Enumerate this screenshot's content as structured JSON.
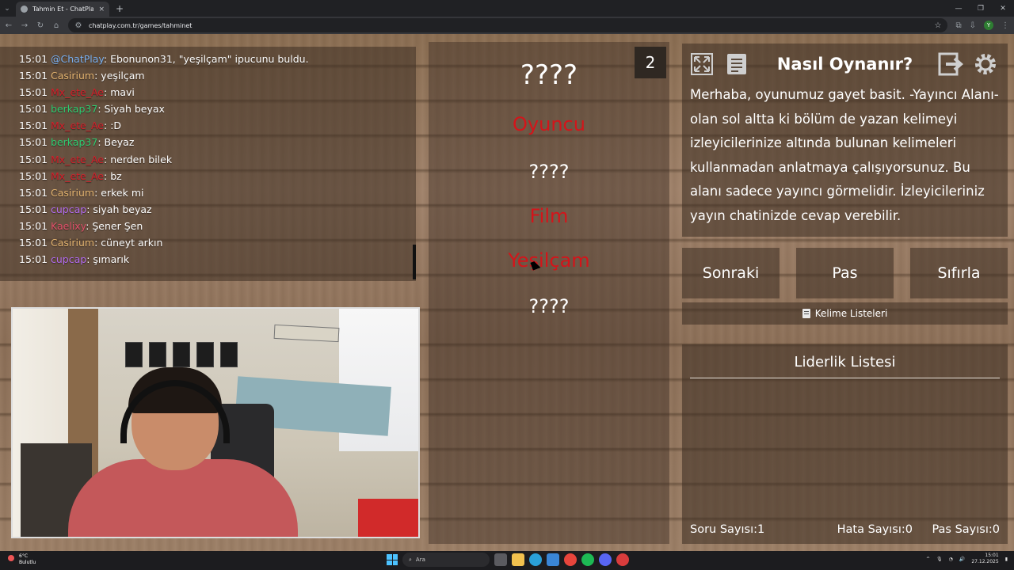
{
  "browser": {
    "tab_title": "Tahmin Et - ChatPlay",
    "url": "chatplay.com.tr/games/tahminet",
    "tab_close": "×",
    "new_tab": "+",
    "profile_initial": "Y"
  },
  "chat": {
    "messages": [
      {
        "time": "15:01",
        "user": "@ChatPlay",
        "color": "#7ab0f0",
        "text": ": Ebonunon31, \"yeşilçam\" ipucunu buldu."
      },
      {
        "time": "15:01",
        "user": "Casirium",
        "color": "#e3b36f",
        "text": ": yeşilçam"
      },
      {
        "time": "15:01",
        "user": "Mx_ete_Ae",
        "color": "#d41e2a",
        "text": ": mavi"
      },
      {
        "time": "15:01",
        "user": "berkap37",
        "color": "#2ecc71",
        "text": ": Siyah beyax"
      },
      {
        "time": "15:01",
        "user": "Mx_ete_Ae",
        "color": "#d41e2a",
        "text": ": :D"
      },
      {
        "time": "15:01",
        "user": "berkap37",
        "color": "#2ecc71",
        "text": ": Beyaz"
      },
      {
        "time": "15:01",
        "user": "Mx_ete_Ae",
        "color": "#d41e2a",
        "text": ": nerden bilek"
      },
      {
        "time": "15:01",
        "user": "Mx_ete_Ae",
        "color": "#d41e2a",
        "text": ": bz"
      },
      {
        "time": "15:01",
        "user": "Casirium",
        "color": "#e3b36f",
        "text": ": erkek mi"
      },
      {
        "time": "15:01",
        "user": "cupcap",
        "color": "#b36bf0",
        "text": ": siyah beyaz"
      },
      {
        "time": "15:01",
        "user": "Kaelixy",
        "color": "#e0506a",
        "text": ": Şener Şen"
      },
      {
        "time": "15:01",
        "user": "Casirium",
        "color": "#e3b36f",
        "text": ": cüneyt arkın"
      },
      {
        "time": "15:01",
        "user": "cupcap",
        "color": "#b36bf0",
        "text": ": şımarık"
      }
    ]
  },
  "game": {
    "round_number": "2",
    "words": [
      {
        "text": "????",
        "state": "hidden",
        "size": 34
      },
      {
        "text": "Oyuncu",
        "state": "shown",
        "size": 24
      },
      {
        "text": "????",
        "state": "hidden",
        "size": 24
      },
      {
        "text": "Film",
        "state": "shown",
        "size": 24
      },
      {
        "text": "Yeşilçam",
        "state": "shown",
        "size": 24
      },
      {
        "text": "????",
        "state": "hidden",
        "size": 24
      }
    ]
  },
  "help": {
    "title": "Nasıl Oynanır?",
    "text": "Merhaba, oyunumuz gayet basit. -Yayıncı Alanı- olan sol altta ki bölüm de yazan kelimeyi izleyicilerinize altında bulunan kelimeleri kullanmadan anlatmaya çalışıyorsunuz. Bu alanı sadece yayıncı görmelidir. İzleyicileriniz yayın chatinizde cevap verebilir.",
    "icons": [
      "fullscreen-icon",
      "document-icon",
      "exit-icon",
      "gear-icon"
    ]
  },
  "controls": {
    "next_label": "Sonraki",
    "pass_label": "Pas",
    "reset_label": "Sıfırla",
    "word_lists_label": "Kelime Listeleri"
  },
  "leaderboard": {
    "title": "Liderlik Listesi",
    "question_count_label": "Soru Sayısı:",
    "question_count": "1",
    "error_count_label": "Hata Sayısı:",
    "error_count": "0",
    "pass_count_label": "Pas Sayısı:",
    "pass_count": "0"
  },
  "taskbar": {
    "weather_temp": "6°C",
    "weather_text": "Bulutlu",
    "search_placeholder": "Ara",
    "time": "15:01",
    "date": "27.12.2025"
  },
  "colors": {
    "revealed_word": "#d4141a",
    "panel_overlay": "rgba(60,45,35,0.55)"
  }
}
